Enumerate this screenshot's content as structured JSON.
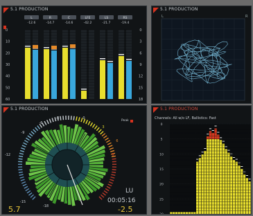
{
  "panels": {
    "levels": {
      "title": "5.1 PRODUCTION",
      "channels": [
        {
          "name": "L",
          "peak": "-12.6",
          "a": 0.74,
          "b": 0.71
        },
        {
          "name": "R",
          "peak": "-14.7",
          "a": 0.72,
          "b": 0.7
        },
        {
          "name": "C",
          "peak": "-14.6",
          "a": 0.74,
          "b": 0.72
        },
        {
          "name": "LFE",
          "peak": "-42.2",
          "a": 0.12,
          "b": 0.0
        },
        {
          "name": "LS",
          "peak": "-21.7",
          "a": 0.56,
          "b": 0.52
        },
        {
          "name": "RS",
          "peak": "-19.4",
          "a": 0.62,
          "b": 0.55
        }
      ],
      "left_scale": [
        "0",
        "10",
        "20",
        "30",
        "40",
        "50",
        "60"
      ],
      "right_scale": [
        "0",
        "3",
        "6",
        "9",
        "12",
        "15",
        "18"
      ]
    },
    "scope": {
      "title": "5.1 PRODUCTION",
      "left_label": "L",
      "right_label": "R"
    },
    "loudness": {
      "title": "5.1 PRODUCTION",
      "peak_label": "Peak",
      "dial_labels": [
        "-9",
        "-6",
        "-3",
        "0",
        "3",
        "6",
        "9",
        "-12",
        "-15",
        "-18"
      ],
      "unit": "LU",
      "time": "00:05:16",
      "left_value": "5.7",
      "right_value": "-2.5"
    },
    "spectrum": {
      "title": "5.1 PRODUCTION",
      "subtitle": "Channels: All w/o LF, Ballistics: Fast",
      "scale": [
        "0",
        "5",
        "10",
        "15",
        "20",
        "25",
        "30"
      ]
    }
  },
  "colors": {
    "yellow": "#e8de2e",
    "blue": "#39a7dc",
    "orange": "#e58a2a",
    "red": "#d7331f",
    "trace": "#7fc7e6"
  }
}
